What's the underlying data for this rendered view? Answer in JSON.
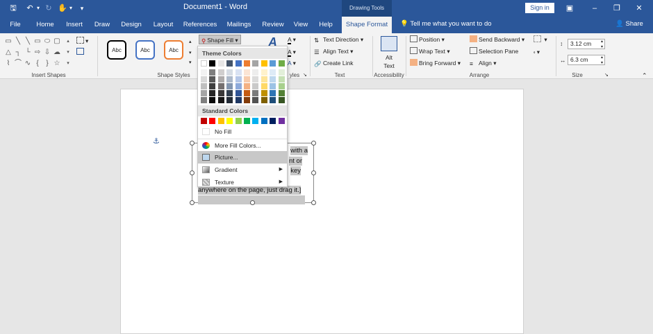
{
  "titlebar": {
    "document_title": "Document1  -  Word",
    "contextual_tab_group": "Drawing Tools",
    "signin_label": "Sign in"
  },
  "menu": {
    "tabs": [
      "File",
      "Home",
      "Insert",
      "Draw",
      "Design",
      "Layout",
      "References",
      "Mailings",
      "Review",
      "View",
      "Help",
      "Shape Format"
    ],
    "active_tab": "Shape Format",
    "tell_me": "Tell me what you want to do",
    "share": "Share"
  },
  "ribbon": {
    "groups": {
      "insert_shapes": "Insert Shapes",
      "shape_styles": "Shape Styles",
      "wordart_styles_partial": "yles",
      "text": "Text",
      "accessibility": "Accessibility",
      "arrange": "Arrange",
      "size": "Size"
    },
    "style_boxes": [
      "Abc",
      "Abc",
      "Abc"
    ],
    "shape_fill": "Shape Fill",
    "text_direction": "Text Direction",
    "align_text": "Align Text",
    "create_link": "Create Link",
    "alt_text_1": "Alt",
    "alt_text_2": "Text",
    "position": "Position",
    "wrap_text": "Wrap Text",
    "bring_forward": "Bring Forward",
    "send_backward": "Send Backward",
    "selection_pane": "Selection Pane",
    "align": "Align",
    "height_value": "3.12 cm",
    "width_value": "6.3 cm"
  },
  "dropdown": {
    "theme_colors_label": "Theme Colors",
    "standard_colors_label": "Standard Colors",
    "no_fill": "No Fill",
    "more_fill_colors": "More Fill Colors...",
    "picture": "Picture...",
    "gradient": "Gradient",
    "texture": "Texture",
    "theme_top_row": [
      "#ffffff",
      "#000000",
      "#e7e6e6",
      "#44546a",
      "#4472c4",
      "#ed7d31",
      "#a5a5a5",
      "#ffc000",
      "#5b9bd5",
      "#70ad47"
    ],
    "theme_shades": [
      [
        "#f2f2f2",
        "#7f7f7f",
        "#d0cece",
        "#d6dce4",
        "#d9e2f3",
        "#fbe5d5",
        "#ededed",
        "#fff2cc",
        "#deebf6",
        "#e2efd9"
      ],
      [
        "#d8d8d8",
        "#595959",
        "#aeabab",
        "#adb9ca",
        "#b4c6e7",
        "#f7cbac",
        "#dbdbdb",
        "#fee599",
        "#bdd7ee",
        "#c5e0b3"
      ],
      [
        "#bfbfbf",
        "#3f3f3f",
        "#757070",
        "#8496b0",
        "#8eaadb",
        "#f4b183",
        "#c9c9c9",
        "#ffd965",
        "#9cc3e5",
        "#a8d08d"
      ],
      [
        "#a5a5a5",
        "#262626",
        "#3a3838",
        "#323f4f",
        "#2f5496",
        "#c55a11",
        "#7b7b7b",
        "#bf9000",
        "#2e75b5",
        "#538135"
      ],
      [
        "#7f7f7f",
        "#0c0c0c",
        "#171616",
        "#222a35",
        "#1f3864",
        "#833c0b",
        "#525252",
        "#7f6000",
        "#1e4e79",
        "#375623"
      ]
    ],
    "standard": [
      "#c00000",
      "#ff0000",
      "#ffc000",
      "#ffff00",
      "#92d050",
      "#00b050",
      "#00b0f0",
      "#0070c0",
      "#002060",
      "#7030a0"
    ]
  },
  "document": {
    "textbox_lines": [
      "with a",
      "nt or",
      "key",
      "anywhere on the page, just drag it.]"
    ]
  }
}
